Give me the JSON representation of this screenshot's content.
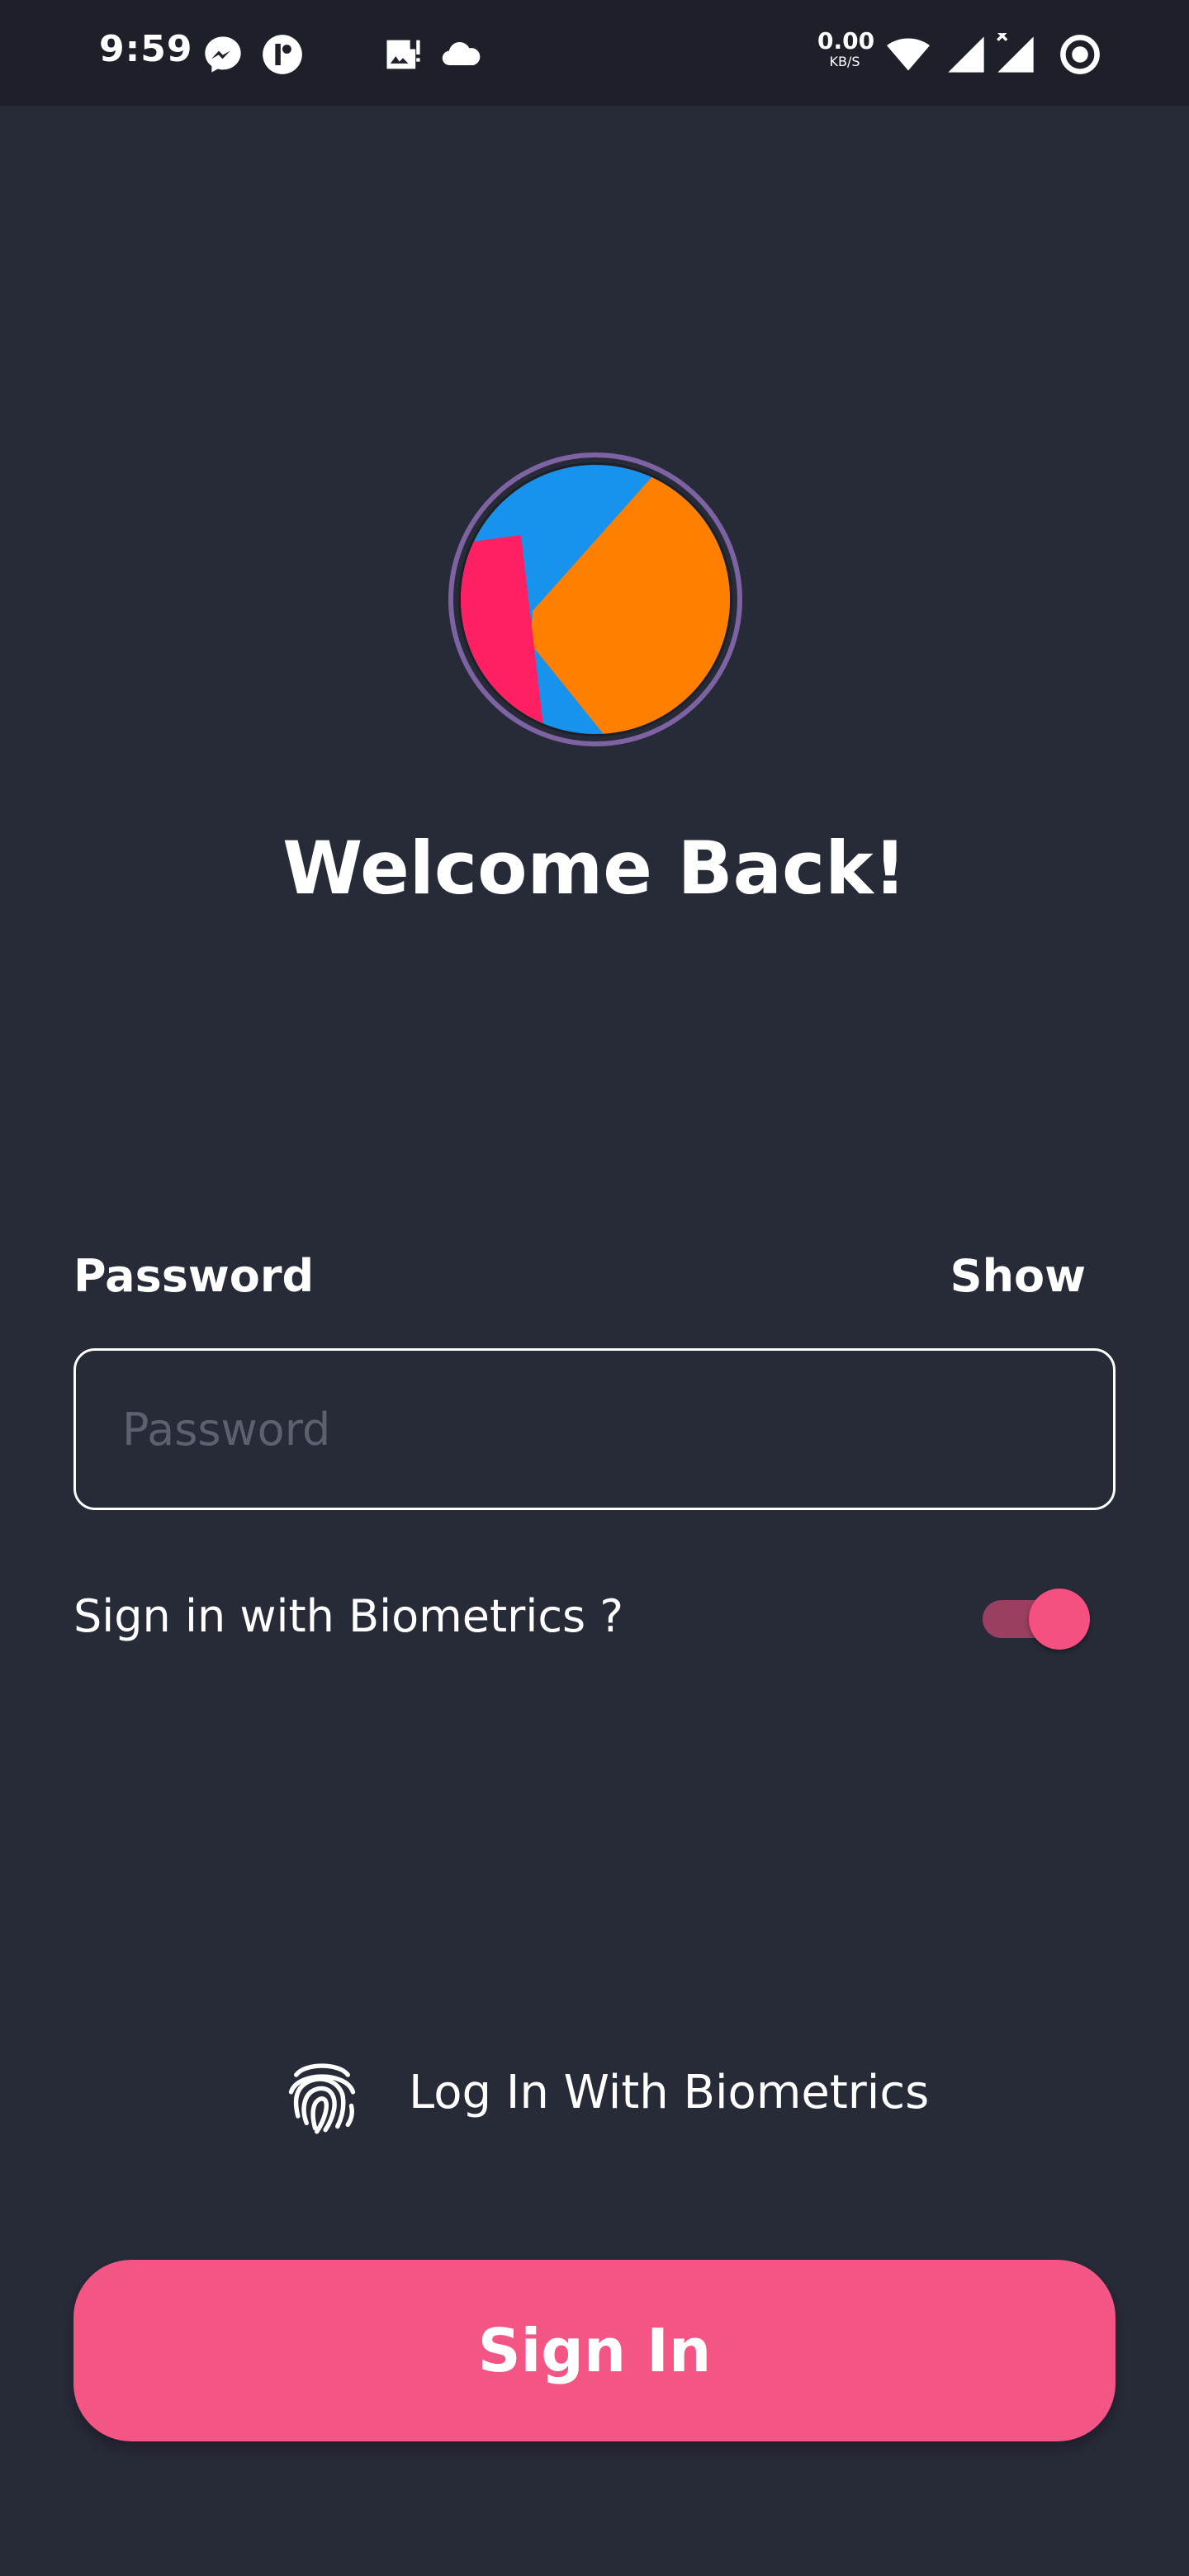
{
  "status_bar": {
    "time": "9:59",
    "net_speed_value": "0.00",
    "net_speed_unit": "KB/S",
    "icons": [
      "messenger-icon",
      "app-notification-icon",
      "image-alert-icon",
      "cloud-icon",
      "wifi-icon",
      "signal-icon",
      "signal-no-data-icon",
      "record-icon"
    ]
  },
  "header": {
    "title": "Welcome Back!"
  },
  "password": {
    "label": "Password",
    "show_label": "Show",
    "placeholder": "Password",
    "value": ""
  },
  "biometrics_toggle": {
    "label": "Sign in with Biometrics ?",
    "enabled": true
  },
  "biometric_login": {
    "label": "Log In With Biometrics",
    "icon": "fingerprint-icon"
  },
  "sign_in_button": {
    "label": "Sign In"
  },
  "colors": {
    "background": "#272a37",
    "status_bar": "#1e2029",
    "accent": "#f35585",
    "logo_blue": "#1793ee",
    "logo_orange": "#ff7f00",
    "logo_pink": "#ff1f63",
    "logo_ring": "#7e63a2"
  }
}
